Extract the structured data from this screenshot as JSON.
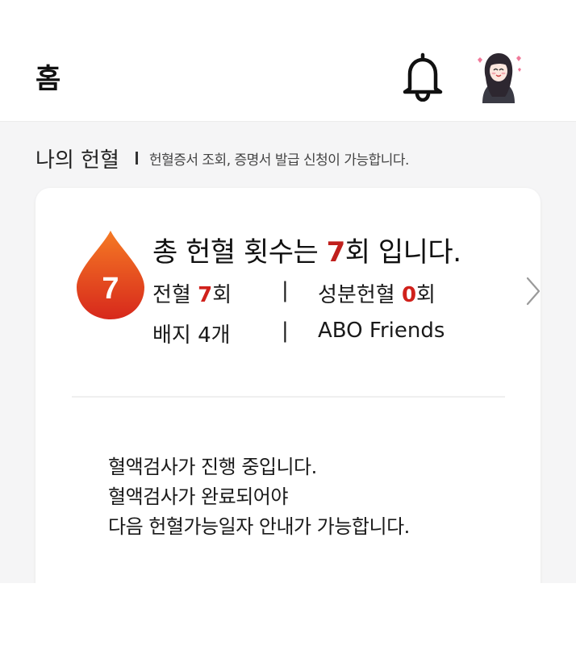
{
  "header": {
    "title": "홈",
    "bell_icon": "bell-icon",
    "avatar_icon": "profile-avatar"
  },
  "section": {
    "title": "나의 헌혈",
    "description": "헌혈증서 조회, 증명서 발급 신청이 가능합니다."
  },
  "card": {
    "drop_number": "7",
    "headline_prefix": "총 헌혈 횟수는 ",
    "headline_count": "7",
    "headline_suffix": "회 입니다.",
    "whole_blood_label": "전혈 ",
    "whole_blood_count": "7",
    "whole_blood_unit": "회",
    "separator": "|",
    "apheresis_label": "성분헌혈 ",
    "apheresis_count": "0",
    "apheresis_unit": "회",
    "badge_text": "배지 4개",
    "badge_name": "ABO Friends",
    "notice_lines": [
      "혈액검사가 진행 중입니다.",
      "혈액검사가 완료되어야",
      "다음 헌혈가능일자 안내가 가능합니다."
    ]
  },
  "colors": {
    "accent_red": "#d0211b",
    "background": "#f5f5f6"
  }
}
